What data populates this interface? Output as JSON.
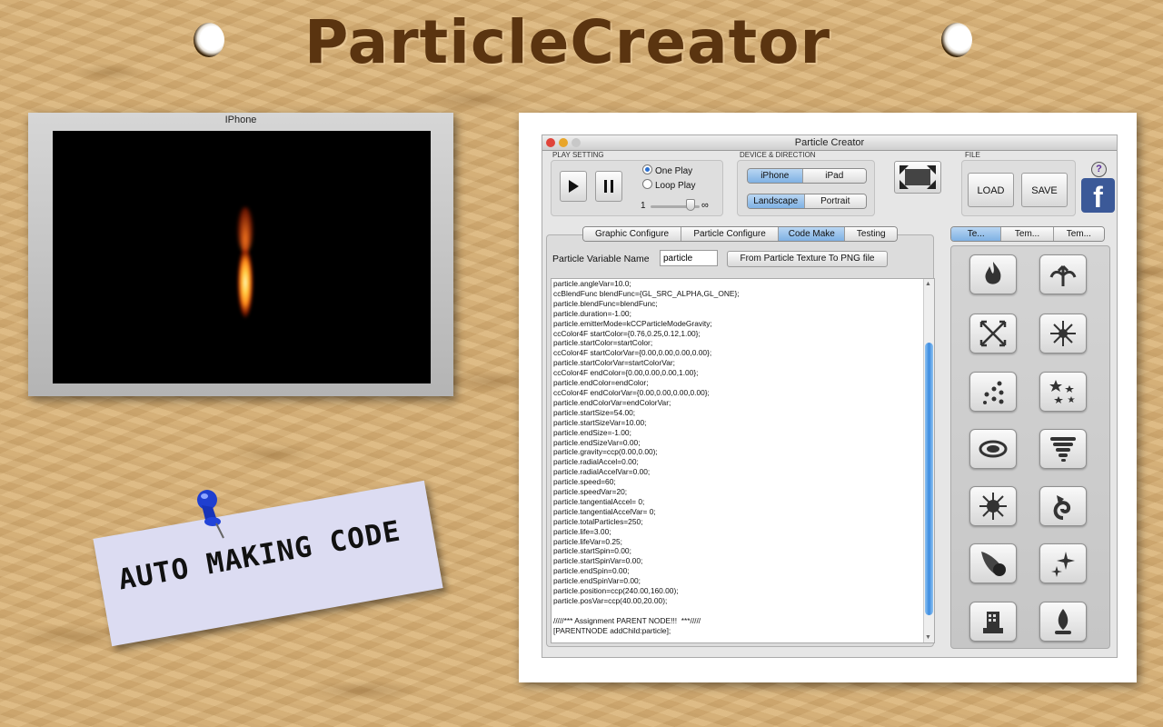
{
  "app_title": "ParticleCreator",
  "iphone_preview": {
    "title": "IPhone"
  },
  "note": {
    "text": "AUTO MAKING CODE"
  },
  "window": {
    "title": "Particle Creator"
  },
  "play_setting": {
    "label": "PLAY SETTING",
    "one_play": "One Play",
    "loop_play": "Loop Play",
    "slider_min": "1",
    "slider_max": "∞"
  },
  "device": {
    "label": "DEVICE & DIRECTION",
    "iphone": "iPhone",
    "ipad": "iPad",
    "landscape": "Landscape",
    "portrait": "Portrait"
  },
  "file": {
    "label": "FILE",
    "load": "LOAD",
    "save": "SAVE"
  },
  "help": "?",
  "facebook": "f",
  "tabs": [
    "Graphic Configure",
    "Particle Configure",
    "Code Make",
    "Testing"
  ],
  "right_tabs": [
    "Te...",
    "Tem...",
    "Tem..."
  ],
  "variable_label": "Particle Variable Name",
  "variable_value": "particle",
  "png_button": "From Particle Texture To PNG file",
  "code_lines": [
    "particle.angleVar=10.0;",
    "ccBlendFunc blendFunc={GL_SRC_ALPHA,GL_ONE};",
    "particle.blendFunc=blendFunc;",
    "particle.duration=-1.00;",
    "particle.emitterMode=kCCParticleModeGravity;",
    "ccColor4F startColor={0.76,0.25,0.12,1.00};",
    "particle.startColor=startColor;",
    "ccColor4F startColorVar={0.00,0.00,0.00,0.00};",
    "particle.startColorVar=startColorVar;",
    "ccColor4F endColor={0.00,0.00,0.00,1.00};",
    "particle.endColor=endColor;",
    "ccColor4F endColorVar={0.00,0.00,0.00,0.00};",
    "particle.endColorVar=endColorVar;",
    "particle.startSize=54.00;",
    "particle.startSizeVar=10.00;",
    "particle.endSize=-1.00;",
    "particle.endSizeVar=0.00;",
    "particle.gravity=ccp(0.00,0.00);",
    "particle.radialAccel=0.00;",
    "particle.radialAccelVar=0.00;",
    "particle.speed=60;",
    "particle.speedVar=20;",
    "particle.tangentialAccel= 0;",
    "particle.tangentialAccelVar= 0;",
    "particle.totalParticles=250;",
    "particle.life=3.00;",
    "particle.lifeVar=0.25;",
    "particle.startSpin=0.00;",
    "particle.startSpinVar=0.00;",
    "particle.endSpin=0.00;",
    "particle.endSpinVar=0.00;",
    "particle.position=ccp(240.00,160.00);",
    "particle.posVar=ccp(40.00,20.00);",
    "",
    "/////*** Assignment PARENT NODE!!!  ***/////",
    "[PARENTNODE addChild:particle];"
  ],
  "colors": {
    "title": "#5a3410",
    "selected_tab": "#8fb9e8",
    "facebook": "#3b5998"
  }
}
